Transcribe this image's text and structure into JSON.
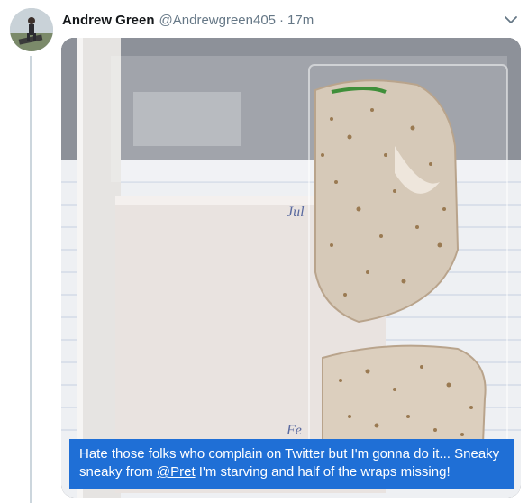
{
  "author": {
    "name": "Andrew Green",
    "handle": "@Andrewgreen405",
    "separator": "·",
    "time": "17m"
  },
  "icons": {
    "avatar": "avatar-photo",
    "more": "chevron-down-icon"
  },
  "caption": {
    "text_before": "Hate those folks who complain on Twitter but I'm gonna do it... Sneaky sneaky from ",
    "mention": "@Pret",
    "text_after": " I'm starving and half of the wraps missing!"
  },
  "photo_text": {
    "note_scrawl_1": "Jul",
    "note_scrawl_2": "Fe"
  },
  "colors": {
    "caption_bg": "#1f6fd6",
    "name": "#14171a",
    "secondary": "#657786",
    "thread_line": "#ccd6dd"
  }
}
